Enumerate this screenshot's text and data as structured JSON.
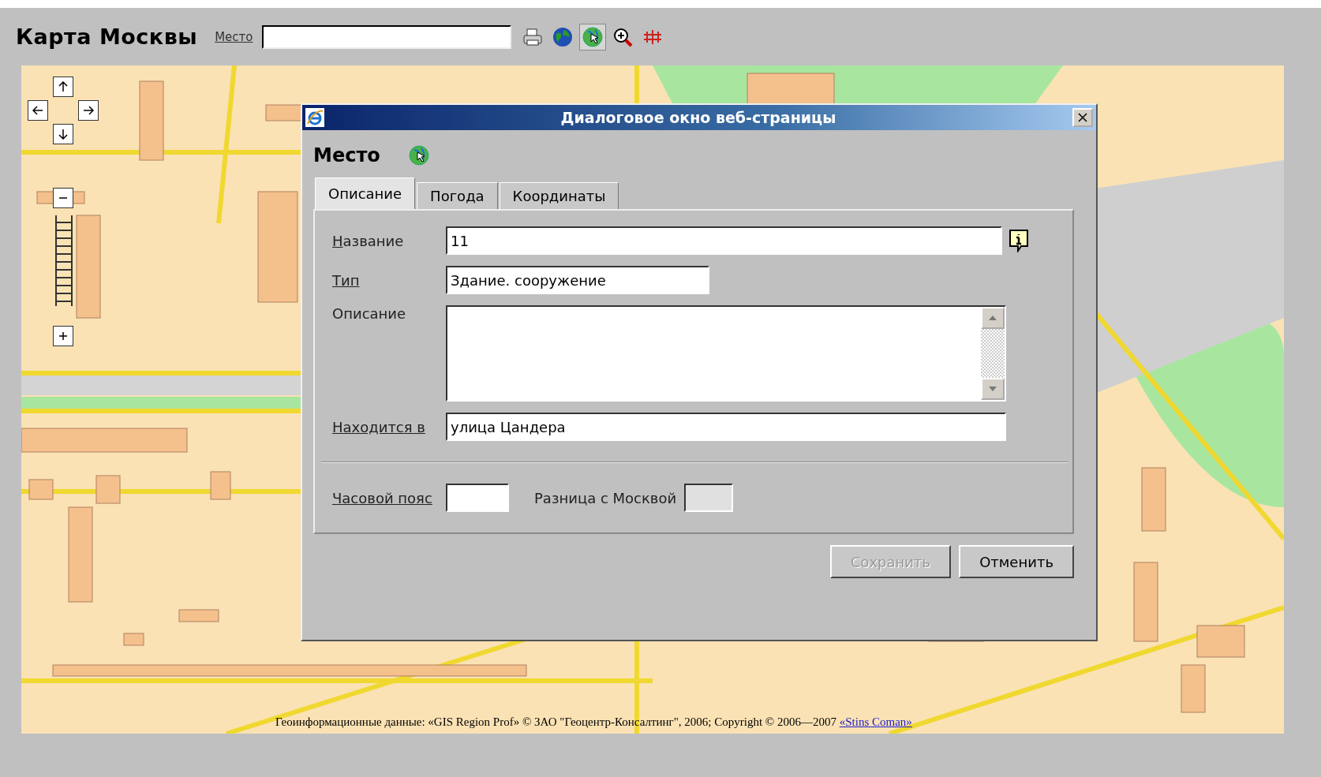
{
  "header": {
    "title": "Карта Москвы",
    "search_label": "Место"
  },
  "tools": [
    {
      "kind": "print",
      "selected": false
    },
    {
      "kind": "globe",
      "selected": false
    },
    {
      "kind": "place",
      "selected": true
    },
    {
      "kind": "zoom",
      "selected": false
    },
    {
      "kind": "ruler",
      "selected": false
    }
  ],
  "dialog": {
    "title": "Диалоговое окно веб-страницы",
    "heading": "Место",
    "tabs": [
      {
        "label": "Описание",
        "selected": true
      },
      {
        "label": "Погода",
        "selected": false
      },
      {
        "label": "Координаты",
        "selected": false
      }
    ],
    "name": {
      "label": "Название",
      "value": "11"
    },
    "type": {
      "label": "Тип",
      "value": "Здание. сооружение"
    },
    "description": {
      "label": "Описание"
    },
    "located_in": {
      "label": "Находится в",
      "value": "улица Цандера"
    },
    "timezone": {
      "label": "Часовой пояс"
    },
    "moscow_diff": {
      "label": "Разница с Москвой",
      "disabled": true
    },
    "buttons": [
      {
        "label": "Сохранить",
        "disabled": true
      },
      {
        "label": "Отменить",
        "disabled": false
      }
    ]
  },
  "attribution": {
    "text": "Геоинформационные данные: «GIS Region Prof» © ЗАО \"Геоцентр-Консалтинг\", 2006; Copyright © 2006—2007",
    "link": "«Stins Coman»"
  }
}
